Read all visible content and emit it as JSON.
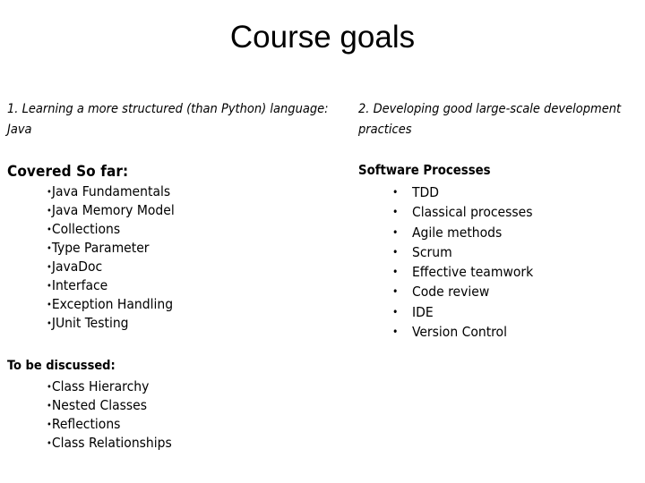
{
  "slide": {
    "title": "Course goals",
    "background_color": "#ffffff",
    "text_color": "#000000"
  },
  "left_column": {
    "intro": "1. Learning a more structured (than Python) language: Java",
    "covered_heading": "Covered So far:",
    "covered_items": [
      "Java Fundamentals",
      "Java Memory Model",
      "Collections",
      "Type Parameter",
      "JavaDoc",
      "Interface",
      "Exception Handling",
      "JUnit Testing"
    ],
    "discussed_heading": "To be discussed:",
    "discussed_items": [
      "Class Hierarchy",
      "Nested Classes",
      "Reflections",
      "Class Relationships"
    ],
    "bullet_glyph": "•"
  },
  "right_column": {
    "intro": "2. Developing good large-scale development practices",
    "processes_heading": "Software Processes",
    "processes_items": [
      "TDD",
      "Classical processes",
      "Agile methods",
      "Scrum",
      "Effective teamwork",
      "Code review",
      "IDE",
      "Version Control"
    ],
    "bullet_glyph": "•"
  }
}
